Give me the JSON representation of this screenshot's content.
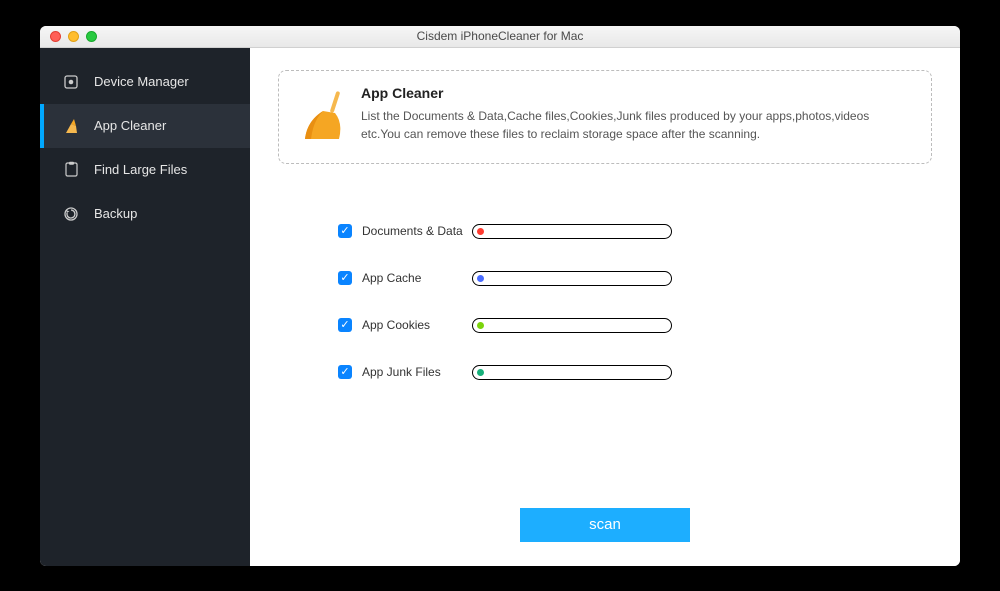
{
  "window": {
    "title": "Cisdem iPhoneCleaner for Mac"
  },
  "sidebar": {
    "items": [
      {
        "label": "Device Manager"
      },
      {
        "label": "App Cleaner"
      },
      {
        "label": "Find Large Files"
      },
      {
        "label": "Backup"
      }
    ],
    "active_index": 1
  },
  "panel": {
    "title": "App Cleaner",
    "description": "List the Documents & Data,Cache files,Cookies,Junk files produced by your apps,photos,videos etc.You can remove these files to reclaim storage space after the scanning."
  },
  "options": [
    {
      "label": "Documents & Data",
      "checked": true,
      "dot_color": "#ff3b30"
    },
    {
      "label": "App Cache",
      "checked": true,
      "dot_color": "#4a6cff"
    },
    {
      "label": "App Cookies",
      "checked": true,
      "dot_color": "#7bd40b"
    },
    {
      "label": "App Junk Files",
      "checked": true,
      "dot_color": "#17b07a"
    }
  ],
  "buttons": {
    "scan": "scan"
  }
}
